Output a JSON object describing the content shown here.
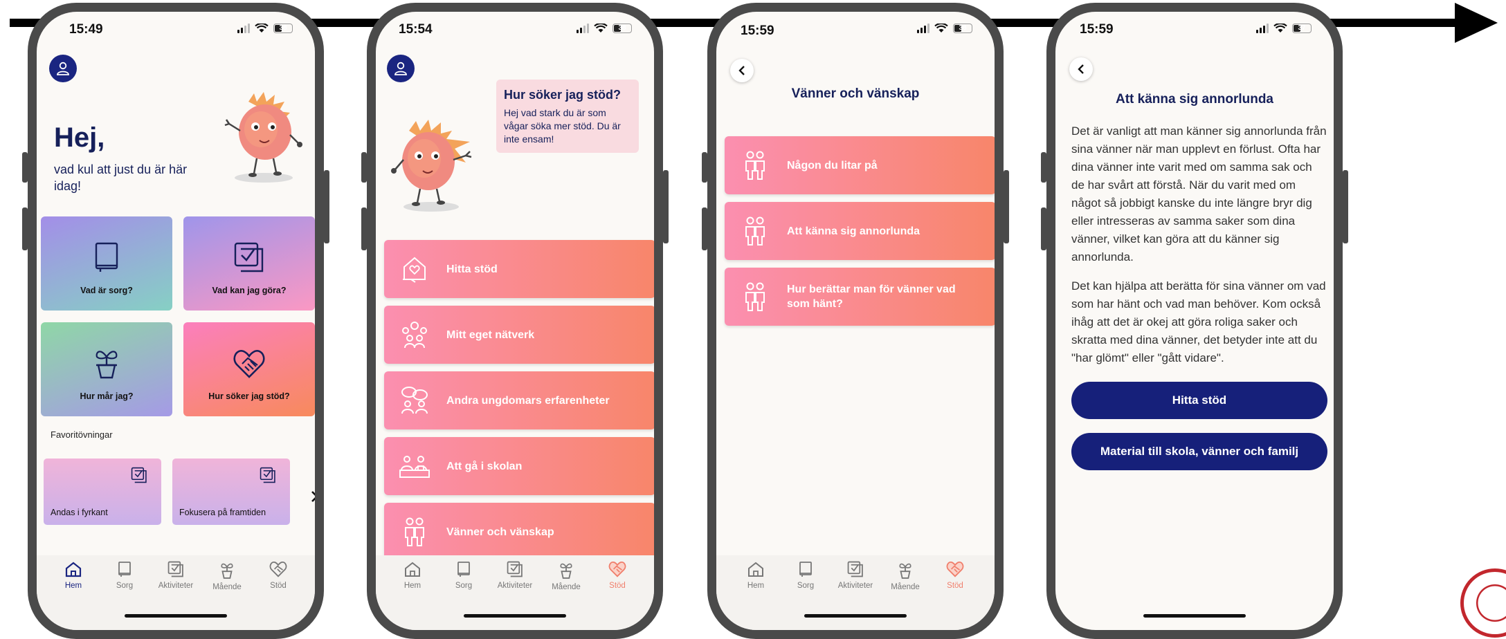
{
  "phones": [
    {
      "time": "15:49",
      "battery": "38",
      "greeting": "Hej,",
      "greeting_sub": "vad kul att just du är här idag!",
      "tiles": [
        {
          "label": "Vad är sorg?",
          "icon": "book-icon"
        },
        {
          "label": "Vad kan jag göra?",
          "icon": "checklist-icon"
        },
        {
          "label": "Hur mår jag?",
          "icon": "plant-icon"
        },
        {
          "label": "Hur söker jag stöd?",
          "icon": "heart-handshake-icon"
        }
      ],
      "favorites_title": "Favoritövningar",
      "favorites": [
        {
          "label": "Andas i fyrkant"
        },
        {
          "label": "Fokusera på framtiden"
        }
      ],
      "active_tab": "Hem"
    },
    {
      "time": "15:54",
      "battery": "38",
      "bubble_title": "Hur söker jag stöd?",
      "bubble_body": "Hej vad stark du är som vågar söka mer stöd. Du är inte ensam!",
      "rows": [
        {
          "label": "Hitta stöd",
          "icon": "house-heart-icon"
        },
        {
          "label": "Mitt eget nätverk",
          "icon": "group-icon"
        },
        {
          "label": "Andra ungdomars erfarenheter",
          "icon": "people-talking-icon"
        },
        {
          "label": "Att gå i skolan",
          "icon": "school-desk-icon"
        },
        {
          "label": "Vänner och vänskap",
          "icon": "friends-icon"
        }
      ],
      "active_tab": "Stöd"
    },
    {
      "time": "15:59",
      "battery": "38",
      "title": "Vänner och vänskap",
      "rows": [
        {
          "label": "Någon du litar på",
          "icon": "friends-icon"
        },
        {
          "label": "Att känna sig annorlunda",
          "icon": "friends-icon"
        },
        {
          "label": "Hur berättar man för vänner vad som hänt?",
          "icon": "friends-icon"
        }
      ],
      "active_tab": "Stöd"
    },
    {
      "time": "15:59",
      "battery": "37",
      "title": "Att känna sig annorlunda",
      "paragraph1": "Det är vanligt att man känner sig annorlunda från sina vänner när man upplevt en förlust. Ofta har dina vänner inte varit med om samma sak och de har svårt att förstå. När du varit med om något så jobbigt kanske du inte längre bryr dig eller intresseras av samma saker som dina vänner, vilket kan göra att du känner sig annorlunda.",
      "paragraph2": "Det kan hjälpa att berätta för sina vänner om vad som har hänt och vad man behöver. Kom också ihåg att det är okej att göra roliga saker och skratta med dina vänner, det betyder inte att du \"har glömt\" eller \"gått vidare\".",
      "button1": "Hitta stöd",
      "button2": "Material till skola, vänner och familj"
    }
  ],
  "tabs": [
    {
      "label": "Hem",
      "icon": "home-icon"
    },
    {
      "label": "Sorg",
      "icon": "book-icon"
    },
    {
      "label": "Aktiviteter",
      "icon": "checklist-icon"
    },
    {
      "label": "Mående",
      "icon": "plant-icon"
    },
    {
      "label": "Stöd",
      "icon": "heart-handshake-icon"
    }
  ],
  "colors": {
    "navy": "#16205a",
    "button_navy": "#16207a",
    "row_gradient_start": "#fb8fb0",
    "row_gradient_end": "#f8866a",
    "active_stod": "#f07e6b",
    "screen_bg": "#fbf9f6"
  }
}
